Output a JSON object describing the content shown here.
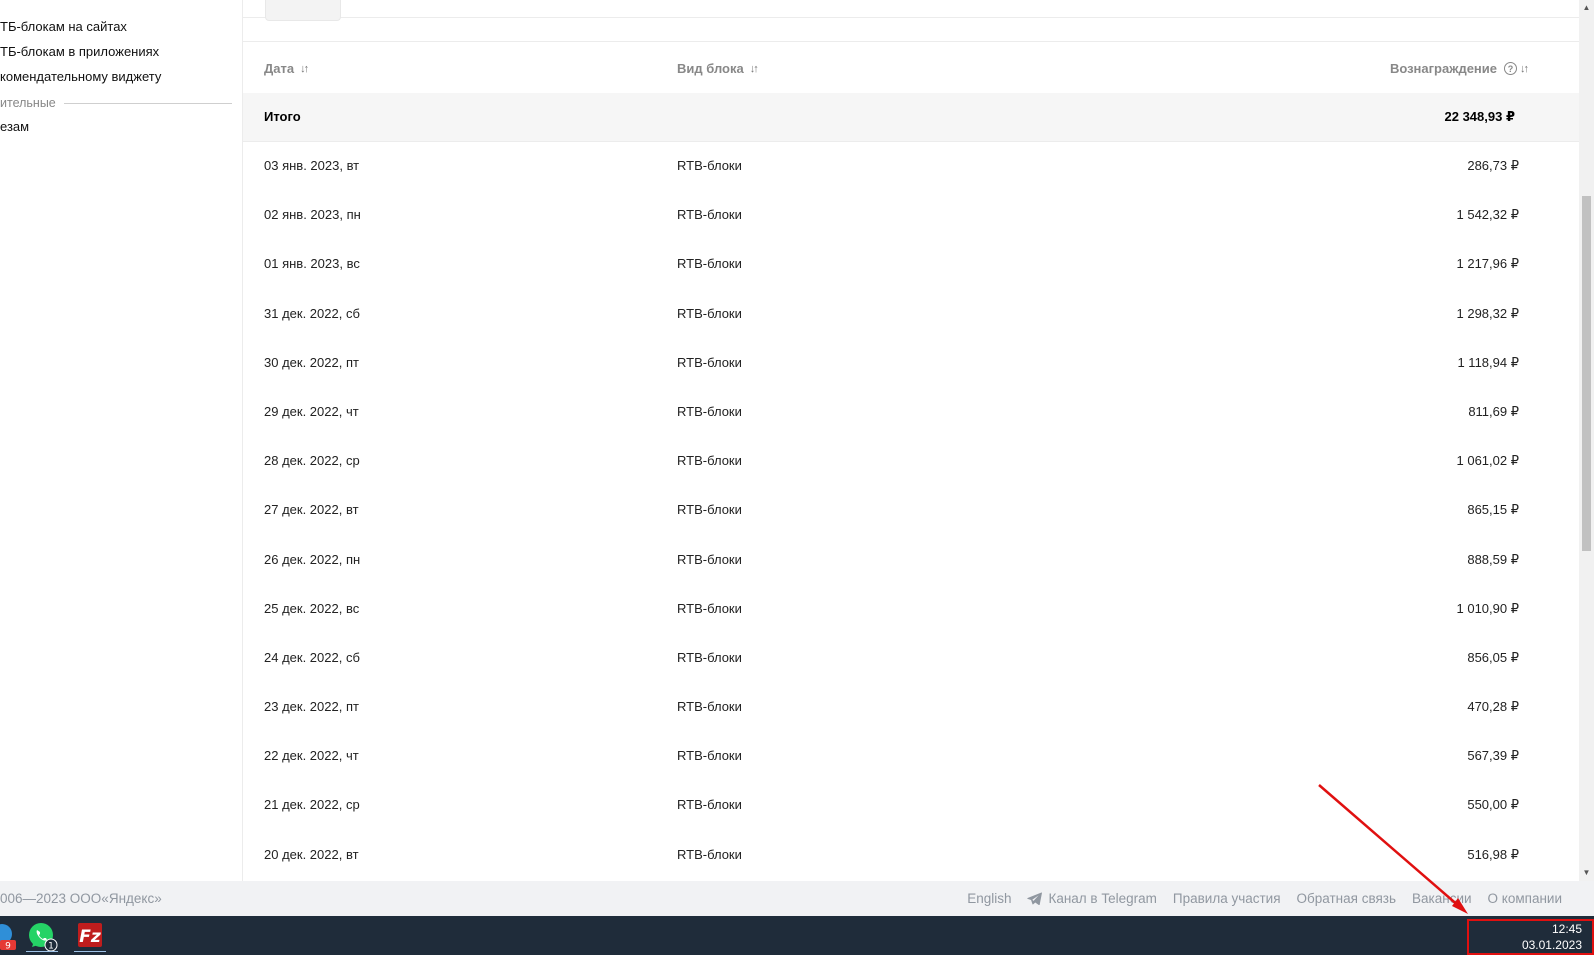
{
  "sidebar": {
    "items": [
      {
        "label": "ТБ-блокам на сайтах"
      },
      {
        "label": "ТБ-блокам в приложениях"
      },
      {
        "label": "комендательному виджету"
      }
    ],
    "section_label": "ительные",
    "extra_item": "езам"
  },
  "table": {
    "columns": [
      {
        "label": "Дата"
      },
      {
        "label": "Вид блока"
      },
      {
        "label": "Вознаграждение"
      }
    ],
    "total": {
      "label": "Итого",
      "value": "22 348,93 ₽"
    },
    "rows": [
      {
        "date": "03 янв. 2023, вт",
        "type": "RTB-блоки",
        "reward": "286,73 ₽"
      },
      {
        "date": "02 янв. 2023, пн",
        "type": "RTB-блоки",
        "reward": "1 542,32 ₽"
      },
      {
        "date": "01 янв. 2023, вс",
        "type": "RTB-блоки",
        "reward": "1 217,96 ₽"
      },
      {
        "date": "31 дек. 2022, сб",
        "type": "RTB-блоки",
        "reward": "1 298,32 ₽"
      },
      {
        "date": "30 дек. 2022, пт",
        "type": "RTB-блоки",
        "reward": "1 118,94 ₽"
      },
      {
        "date": "29 дек. 2022, чт",
        "type": "RTB-блоки",
        "reward": "811,69 ₽"
      },
      {
        "date": "28 дек. 2022, ср",
        "type": "RTB-блоки",
        "reward": "1 061,02 ₽"
      },
      {
        "date": "27 дек. 2022, вт",
        "type": "RTB-блоки",
        "reward": "865,15 ₽"
      },
      {
        "date": "26 дек. 2022, пн",
        "type": "RTB-блоки",
        "reward": "888,59 ₽"
      },
      {
        "date": "25 дек. 2022, вс",
        "type": "RTB-блоки",
        "reward": "1 010,90 ₽"
      },
      {
        "date": "24 дек. 2022, сб",
        "type": "RTB-блоки",
        "reward": "856,05 ₽"
      },
      {
        "date": "23 дек. 2022, пт",
        "type": "RTB-блоки",
        "reward": "470,28 ₽"
      },
      {
        "date": "22 дек. 2022, чт",
        "type": "RTB-блоки",
        "reward": "567,39 ₽"
      },
      {
        "date": "21 дек. 2022, ср",
        "type": "RTB-блоки",
        "reward": "550,00 ₽"
      },
      {
        "date": "20 дек. 2022, вт",
        "type": "RTB-блоки",
        "reward": "516,98 ₽"
      }
    ]
  },
  "footer": {
    "copyright": "006—2023 ООО«Яндекс»",
    "links": [
      {
        "label": "English"
      },
      {
        "label": "Канал в Telegram",
        "icon": "telegram-icon"
      },
      {
        "label": "Правила участия"
      },
      {
        "label": "Обратная связь"
      },
      {
        "label": "Вакансии"
      },
      {
        "label": "О компании"
      }
    ]
  },
  "taskbar": {
    "apps": [
      {
        "icon": "partial-app-icon",
        "badge": "9"
      },
      {
        "icon": "whatsapp-icon",
        "badge": "1"
      },
      {
        "icon": "filezilla-icon"
      }
    ],
    "clock": {
      "time": "12:45",
      "date": "03.01.2023"
    }
  },
  "colors": {
    "annotation": "#e01010",
    "taskbar_bg": "#1f2c3a",
    "whatsapp": "#25d366",
    "filezilla": "#bf1d1d"
  }
}
